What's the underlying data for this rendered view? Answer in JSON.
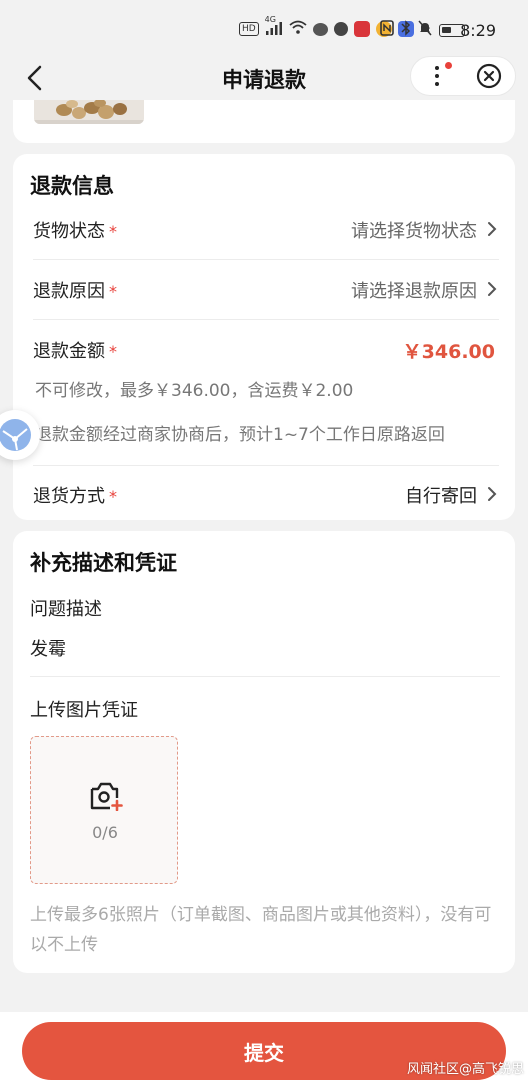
{
  "status_bar": {
    "network_badge": "HD",
    "signal_label": "4G",
    "time": "8:29",
    "icons": [
      "hd-icon",
      "signal-icon",
      "wifi-icon",
      "wechat-icon",
      "app-icon",
      "red-app-icon",
      "weibo-icon",
      "blue-app-icon",
      "more-dots-icon",
      "nfc-icon",
      "bluetooth-icon",
      "mute-icon",
      "battery-icon"
    ]
  },
  "nav": {
    "title": "申请退款",
    "back_icon": "back-arrow-icon",
    "more_icon": "more-icon",
    "close_icon": "close-circle-icon"
  },
  "refund_info": {
    "title": "退款信息",
    "goods_status": {
      "label": "货物状态",
      "required": "*",
      "placeholder": "请选择货物状态"
    },
    "refund_reason": {
      "label": "退款原因",
      "required": "*",
      "placeholder": "请选择退款原因"
    },
    "refund_amount": {
      "label": "退款金额",
      "required": "*",
      "value": "￥346.00",
      "note1": "不可修改，最多￥346.00，含运费￥2.00",
      "note2": "退款金额经过商家协商后，预计1~7个工作日原路返回"
    },
    "return_method": {
      "label": "退货方式",
      "required": "*",
      "value": "自行寄回"
    }
  },
  "supplement": {
    "title": "补充描述和凭证",
    "desc_label": "问题描述",
    "desc_value": "发霉",
    "upload_label": "上传图片凭证",
    "upload_count": "0/6",
    "upload_hint": "上传最多6张照片（订单截图、商品图片或其他资料），没有可以不上传"
  },
  "footer": {
    "submit_label": "提交",
    "watermark": "风闻社区@高飞锐思"
  },
  "colors": {
    "accent": "#e4553f",
    "required_star": "#e8413a",
    "background": "#f2f2f2"
  }
}
